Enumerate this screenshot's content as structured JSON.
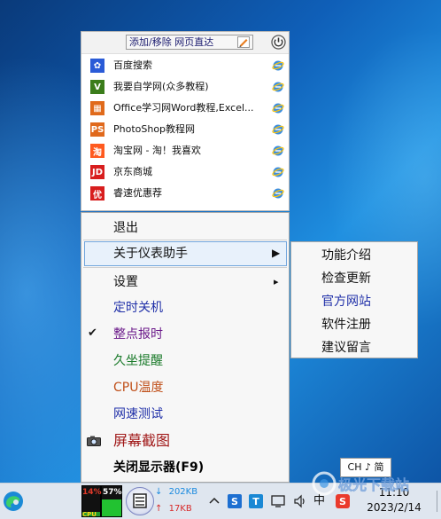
{
  "favorites": {
    "add_button_label": "添加/移除 网页直达",
    "items": [
      {
        "label": "百度搜索",
        "icon": "baidu-paw-icon",
        "icon_color": "#2a5bd7",
        "icon_text": "✿"
      },
      {
        "label": "我要自学网(众多教程)",
        "icon": "zixue-logo-icon",
        "icon_color": "#3b7d1b",
        "icon_text": "V"
      },
      {
        "label": "Office学习网Word教程,Excel...",
        "icon": "office-logo-icon",
        "icon_color": "#e06a1b",
        "icon_text": "▦"
      },
      {
        "label": "PhotoShop教程网",
        "icon": "ps-logo-icon",
        "icon_color": "#e0691c",
        "icon_text": "PS"
      },
      {
        "label": "淘宝网 - 淘！我喜欢",
        "icon": "taobao-logo-icon",
        "icon_color": "#ff5a1f",
        "icon_text": "淘"
      },
      {
        "label": "京东商城",
        "icon": "jd-logo-icon",
        "icon_color": "#d81e1e",
        "icon_text": "JD"
      },
      {
        "label": "睿速优惠荐",
        "icon": "you-logo-icon",
        "icon_color": "#d81e1e",
        "icon_text": "优"
      }
    ]
  },
  "menu": {
    "items": [
      {
        "label": "退出",
        "color": "#111111"
      },
      {
        "label": "关于仪表助手",
        "color": "#111111",
        "highlighted": true,
        "has_submenu": true
      },
      {
        "label": "设置",
        "color": "#111111",
        "has_submenu": true
      },
      {
        "label": "定时关机",
        "color": "#1f2fa8"
      },
      {
        "label": "整点报时",
        "color": "#6b1a8a",
        "checked": true
      },
      {
        "label": "久坐提醒",
        "color": "#1a7a2a"
      },
      {
        "label": "CPU温度",
        "color": "#c0501a"
      },
      {
        "label": "网速测试",
        "color": "#1f2fa8"
      },
      {
        "label": "屏幕截图",
        "color": "#a01818",
        "has_camera": true
      },
      {
        "label": "关闭显示器(F9)",
        "color": "#000000",
        "bold": true
      }
    ]
  },
  "submenu": {
    "items": [
      {
        "label": "功能介绍",
        "color": "#111111"
      },
      {
        "label": "检查更新",
        "color": "#111111"
      },
      {
        "label": "官方网站",
        "color": "#1f2fa8"
      },
      {
        "label": "软件注册",
        "color": "#111111"
      },
      {
        "label": "建议留言",
        "color": "#111111"
      }
    ]
  },
  "ime_tooltip": "CH ♪ 简",
  "taskbar": {
    "cpu_percent_label": "14%",
    "cpu_fraction": 0.14,
    "mem_percent_label": "57%",
    "mem_fraction": 0.57,
    "cpu_text": "CPU",
    "download_speed": "202KB",
    "upload_speed": "17KB",
    "ime_label": "中",
    "time": "11:10",
    "date": "2023/2/14"
  },
  "watermark": "极光下载站",
  "colors": {
    "highlight_bg": "#e8f1fb",
    "highlight_border": "#74a7dd",
    "menu_bg": "#f7f7f7",
    "meter_green": "#22c231"
  }
}
